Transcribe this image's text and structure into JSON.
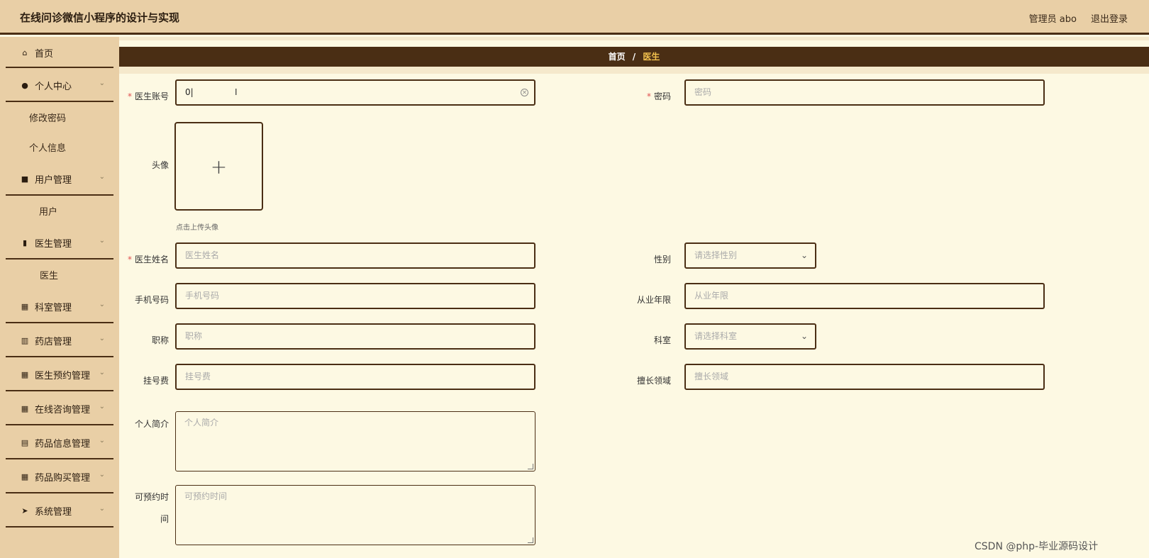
{
  "header": {
    "title": "在线问诊微信小程序的设计与实现",
    "user": "管理员 abo",
    "logout": "退出登录"
  },
  "sidebar": {
    "home": "首页",
    "personal_center": "个人中心",
    "change_password": "修改密码",
    "personal_info": "个人信息",
    "user_mgmt": "用户管理",
    "user": "用户",
    "doctor_mgmt": "医生管理",
    "doctor": "医生",
    "dept_mgmt": "科室管理",
    "pharmacy_mgmt": "药店管理",
    "appointment_mgmt": "医生预约管理",
    "consult_mgmt": "在线咨询管理",
    "drug_info_mgmt": "药品信息管理",
    "drug_purchase_mgmt": "药品购买管理",
    "system_mgmt": "系统管理"
  },
  "breadcrumb": {
    "home": "首页",
    "separator": "/",
    "current": "医生"
  },
  "form": {
    "account": {
      "label": "医生账号",
      "value": "0"
    },
    "password": {
      "label": "密码",
      "placeholder": "密码"
    },
    "avatar": {
      "label": "头像",
      "hint": "点击上传头像"
    },
    "name": {
      "label": "医生姓名",
      "placeholder": "医生姓名"
    },
    "gender": {
      "label": "性别",
      "placeholder": "请选择性别"
    },
    "phone": {
      "label": "手机号码",
      "placeholder": "手机号码"
    },
    "years": {
      "label": "从业年限",
      "placeholder": "从业年限"
    },
    "title": {
      "label": "职称",
      "placeholder": "职称"
    },
    "dept": {
      "label": "科室",
      "placeholder": "请选择科室"
    },
    "fee": {
      "label": "挂号费",
      "placeholder": "挂号费"
    },
    "specialty": {
      "label": "擅长领域",
      "placeholder": "擅长领域"
    },
    "intro": {
      "label": "个人简介",
      "placeholder": "个人简介"
    },
    "available_time": {
      "label_1": "可预约时",
      "label_2": "间",
      "placeholder": "可预约时间"
    }
  },
  "watermark": "CSDN @php-毕业源码设计"
}
